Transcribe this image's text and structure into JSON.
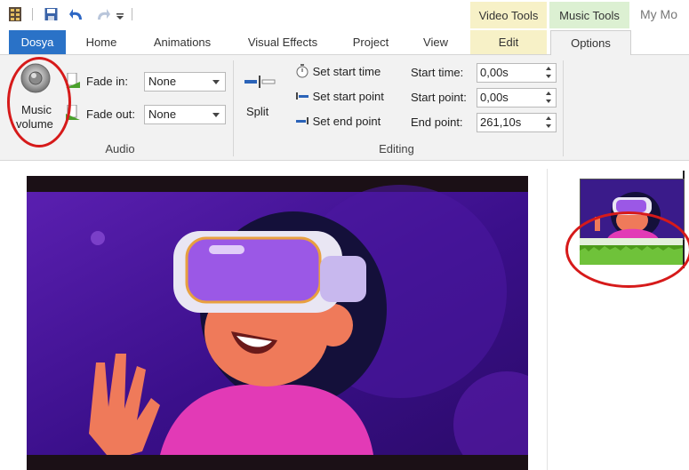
{
  "qat": {
    "icons": [
      "app-icon",
      "save-icon",
      "undo-icon",
      "redo-icon",
      "customize-qat-icon"
    ]
  },
  "context": {
    "video_tools": "Video Tools",
    "music_tools": "Music Tools"
  },
  "window_title": "My Mo",
  "tabs": {
    "file": "Dosya",
    "home": "Home",
    "animations": "Animations",
    "visual_effects": "Visual Effects",
    "project": "Project",
    "view": "View",
    "edit": "Edit",
    "options": "Options"
  },
  "audio": {
    "music_volume_line1": "Music",
    "music_volume_line2": "volume",
    "fade_in_label": "Fade in:",
    "fade_in_value": "None",
    "fade_out_label": "Fade out:",
    "fade_out_value": "None",
    "group_label": "Audio"
  },
  "editing": {
    "split_label": "Split",
    "set_start_time": "Set start time",
    "set_start_point": "Set start point",
    "set_end_point": "Set end point",
    "start_time_label": "Start time:",
    "start_time_value": "0,00s",
    "start_point_label": "Start point:",
    "start_point_value": "0,00s",
    "end_point_label": "End point:",
    "end_point_value": "261,10s",
    "group_label": "Editing"
  },
  "colors": {
    "file_tab": "#2a72c7",
    "video_tools": "#f7f1c7",
    "music_tools": "#dcf0d2",
    "annotation": "#d61a1a",
    "audio_track": "#4d9b1a"
  }
}
